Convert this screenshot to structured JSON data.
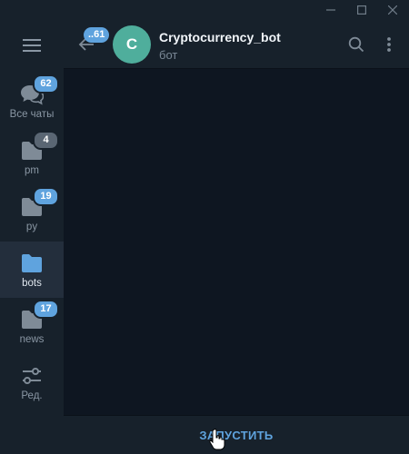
{
  "window_controls": {
    "minimize_icon": "minimize-icon",
    "maximize_icon": "maximize-icon",
    "close_icon": "close-icon"
  },
  "sidebar": {
    "menu_icon": "hamburger-menu-icon",
    "folders": [
      {
        "label": "Все чаты",
        "badge": "62",
        "icon": "chats-icon",
        "active": false
      },
      {
        "label": "pm",
        "badge": "4",
        "icon": "folder-icon",
        "active": false
      },
      {
        "label": "py",
        "badge": "19",
        "icon": "folder-icon",
        "active": false
      },
      {
        "label": "bots",
        "badge": "",
        "icon": "folder-icon",
        "active": true
      },
      {
        "label": "news",
        "badge": "17",
        "icon": "folder-icon",
        "active": false
      },
      {
        "label": "Ред.",
        "badge": "",
        "icon": "edit-sliders-icon",
        "active": false
      }
    ]
  },
  "header": {
    "back_badge": "..61",
    "avatar_letter": "C",
    "title": "Cryptocurrency_bot",
    "subtitle": "бот"
  },
  "start_bar": {
    "button_label": "ЗАПУСТИТЬ"
  },
  "colors": {
    "accent": "#5fa3de",
    "avatar": "#4fae9c",
    "sidebar_bg": "#17212b",
    "chat_bg": "#0e1621",
    "active_folder_bg": "#232e3c"
  }
}
